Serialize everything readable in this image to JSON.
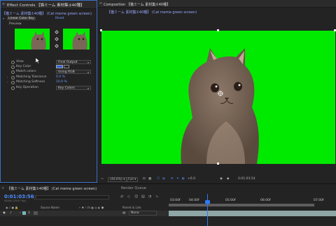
{
  "effect_controls": {
    "tab_label": "Effect Controls 【猫ミーム 素材集①40種】",
    "source_label": "【猫ミーム 素材集①40種】 (Cat meme green screen)",
    "effect_name": "Linear Color Key",
    "reset_label": "Reset",
    "preview_label": "Preview",
    "properties": [
      {
        "label": "View",
        "value": "Final Output",
        "kind": "dropdown"
      },
      {
        "label": "Key Color",
        "value": "",
        "kind": "color",
        "color": "#2f5fd6"
      },
      {
        "label": "Match colors",
        "value": "Using RGB",
        "kind": "dropdown"
      },
      {
        "label": "Matching Tolerance",
        "value": "0.0 %",
        "kind": "value"
      },
      {
        "label": "Matching Softness",
        "value": "10.0 %",
        "kind": "value"
      },
      {
        "label": "Key Operation",
        "value": "Key Colors",
        "kind": "dropdown"
      }
    ]
  },
  "composition": {
    "tab_label": "Composition 【猫ミーム 素材集①40種】",
    "sub_label": "【猫ミーム 素材集①40種】 (Cat meme green screen)",
    "viewer": {
      "zoom": "(40.6%)",
      "resolution": "Full",
      "exposure": "+0.0",
      "timecode": "0:01:03:54"
    }
  },
  "timeline": {
    "tab_label": "【猫ミーム 素材集①40種】 (Cat meme green screen)",
    "render_queue": "Render Queue",
    "current_time": "0:01:03:56",
    "frame_info": "00000 (29.97 fps)",
    "ruler": [
      "03:00f",
      "04:00f",
      "05:00f",
      "06:00f",
      "07:00f"
    ],
    "col_source": "Source Name",
    "col_parent": "Parent & Link",
    "layer_index": "1",
    "parent_value": "None"
  },
  "colors": {
    "accent": "#2c7bff",
    "green_screen": "#00ea00"
  }
}
